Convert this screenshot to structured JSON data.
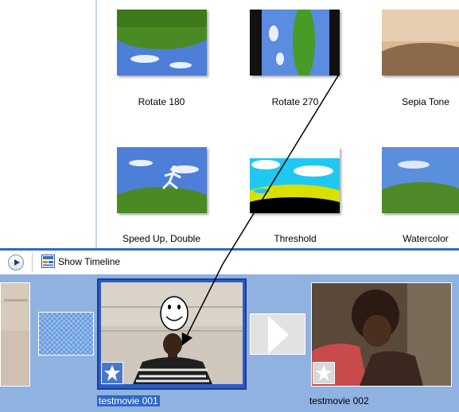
{
  "effects": [
    {
      "label": "Rotate 180"
    },
    {
      "label": "Rotate 270"
    },
    {
      "label": "Sepia Tone"
    },
    {
      "label": "Speed Up, Double"
    },
    {
      "label": "Threshold"
    },
    {
      "label": "Watercolor"
    }
  ],
  "toolbar": {
    "show_timeline_label": "Show Timeline"
  },
  "storyboard": {
    "clips": [
      {
        "label": "testmovie 001",
        "selected": true
      },
      {
        "label": "testmovie 002",
        "selected": false
      }
    ]
  },
  "annotation": {
    "face_icon": "smiley-face-icon"
  },
  "colors": {
    "accent": "#316ac5",
    "storyboard_bg": "#8fb2e0"
  }
}
